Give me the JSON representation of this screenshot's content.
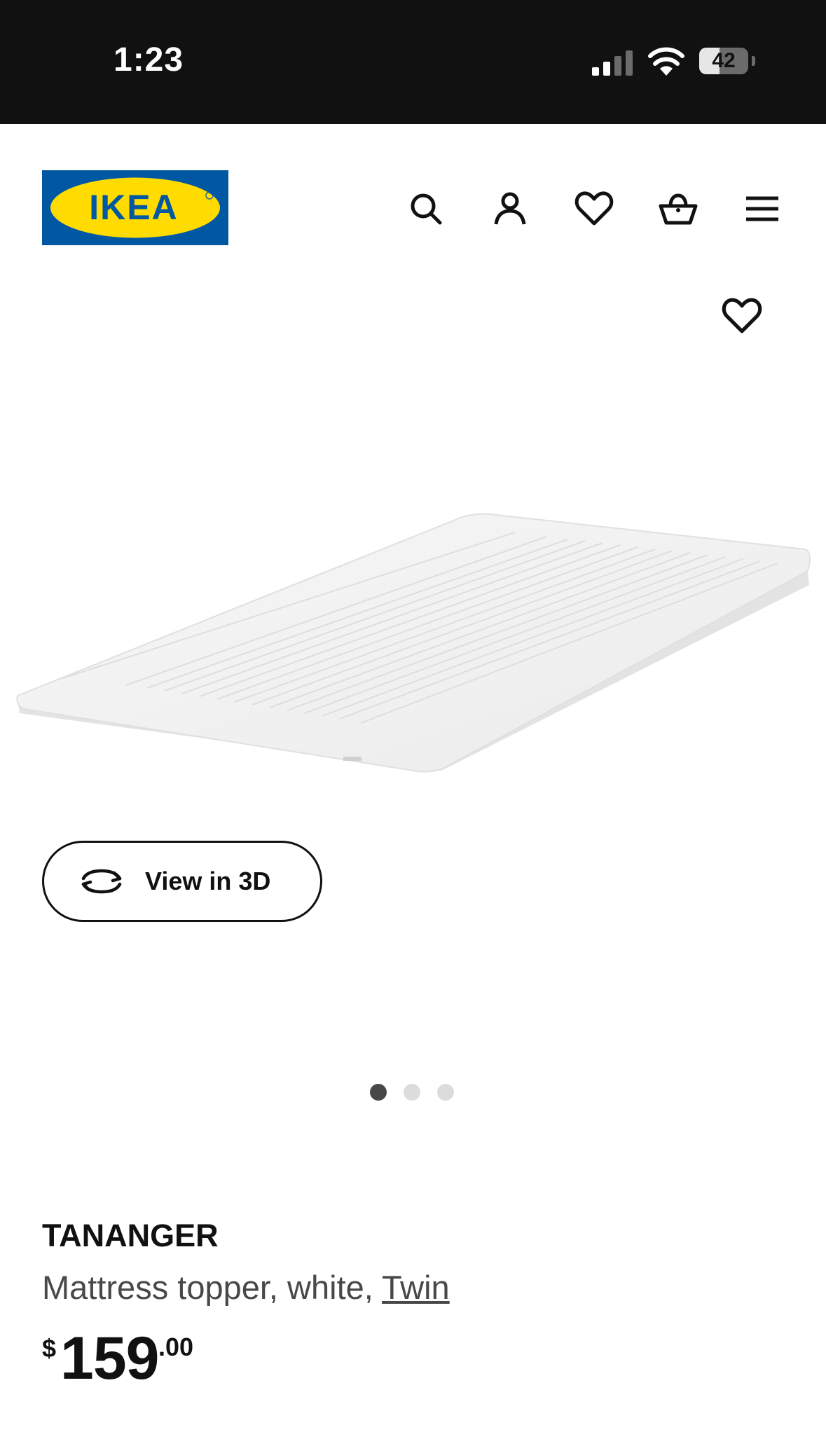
{
  "status_bar": {
    "time": "1:23",
    "battery_level": "42",
    "icons": [
      "signal-icon",
      "wifi-icon",
      "battery-icon"
    ]
  },
  "header": {
    "logo_text": "IKEA",
    "logo_colors": {
      "background": "#0058a3",
      "oval": "#ffdb00",
      "text": "#0058a3"
    },
    "icons": [
      "search-icon",
      "account-icon",
      "heart-icon",
      "basket-icon",
      "menu-icon"
    ]
  },
  "gallery": {
    "view_3d_label": "View in 3D",
    "image_count": 3,
    "active_index": 0
  },
  "product": {
    "name": "TANANGER",
    "description": "Mattress topper, white, ",
    "size_link": "Twin",
    "price": {
      "currency": "$",
      "integer": "159",
      "decimal": ".00"
    }
  }
}
